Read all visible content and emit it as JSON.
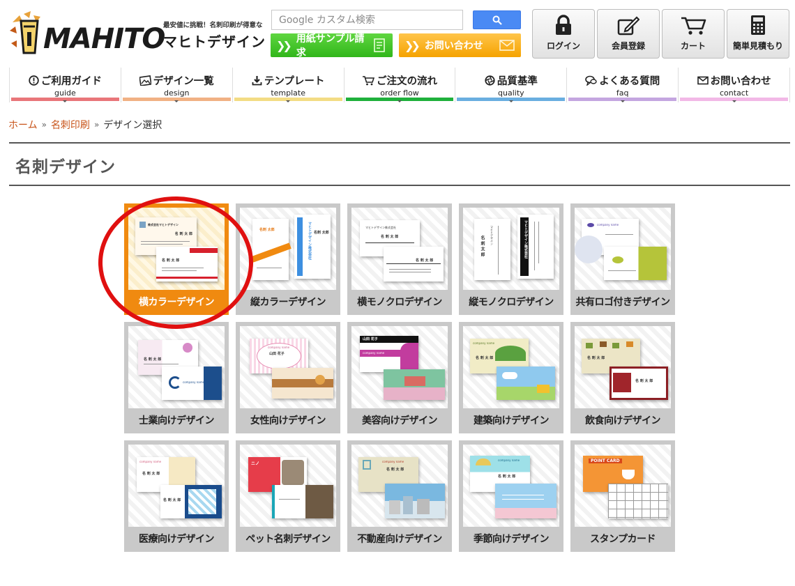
{
  "header": {
    "logo_text": "MAHITO",
    "logo_catch": "最安値に挑戦！名刺印刷が得意な",
    "logo_name": "マヒトデザイン",
    "search_placeholder": "Google カスタム検索",
    "banners": [
      {
        "label": "用紙サンプル請求",
        "color": "#3cbc22"
      },
      {
        "label": "お問い合わせ",
        "color": "#f7ad16"
      }
    ],
    "buttons": [
      {
        "label": "ログイン",
        "icon": "lock-icon"
      },
      {
        "label": "会員登録",
        "icon": "edit-icon"
      },
      {
        "label": "カート",
        "icon": "cart-icon"
      },
      {
        "label": "簡単見積もり",
        "icon": "calculator-icon"
      }
    ]
  },
  "nav": [
    {
      "label": "ご利用ガイド",
      "en": "guide",
      "icon": "info-icon",
      "color": "#e9767a"
    },
    {
      "label": "デザイン一覧",
      "en": "design",
      "icon": "image-icon",
      "color": "#f1b184"
    },
    {
      "label": "テンプレート",
      "en": "template",
      "icon": "download-icon",
      "color": "#f3dc84"
    },
    {
      "label": "ご注文の流れ",
      "en": "order flow",
      "icon": "cart-icon",
      "color": "#1fb03c"
    },
    {
      "label": "品質基準",
      "en": "quality",
      "icon": "aperture-icon",
      "color": "#6aaee0"
    },
    {
      "label": "よくある質問",
      "en": "faq",
      "icon": "chat-icon",
      "color": "#c4a6e0"
    },
    {
      "label": "お問い合わせ",
      "en": "contact",
      "icon": "mail-icon",
      "color": "#f2b8e6"
    }
  ],
  "breadcrumb": {
    "home": "ホーム",
    "sep": "»",
    "parent": "名刺印刷",
    "current": "デザイン選択"
  },
  "page_title": "名刺デザイン",
  "designs": [
    {
      "label": "横カラーデザイン",
      "active": true
    },
    {
      "label": "縦カラーデザイン"
    },
    {
      "label": "横モノクロデザイン"
    },
    {
      "label": "縦モノクロデザイン"
    },
    {
      "label": "共有ロゴ付きデザイン"
    },
    {
      "label": "士業向けデザイン"
    },
    {
      "label": "女性向けデザイン"
    },
    {
      "label": "美容向けデザイン"
    },
    {
      "label": "建築向けデザイン"
    },
    {
      "label": "飲食向けデザイン"
    },
    {
      "label": "医療向けデザイン"
    },
    {
      "label": "ペット名刺デザイン"
    },
    {
      "label": "不動産向けデザイン"
    },
    {
      "label": "季節向けデザイン"
    },
    {
      "label": "スタンプカード"
    }
  ],
  "thumb_text": {
    "yoko_company": "株式会社マヒトデザイン",
    "person": "名 刺 太 郎",
    "tate_company": "マヒトデザイン株式会社",
    "tate_name": "名刺 太郎",
    "mono_company": "マヒトデザイン株式会社",
    "company_name": "company name",
    "female_name": "山田 花子",
    "point_card": "POINT CARD"
  },
  "annotation": {
    "highlight": "red-circle",
    "color": "#e01010"
  }
}
